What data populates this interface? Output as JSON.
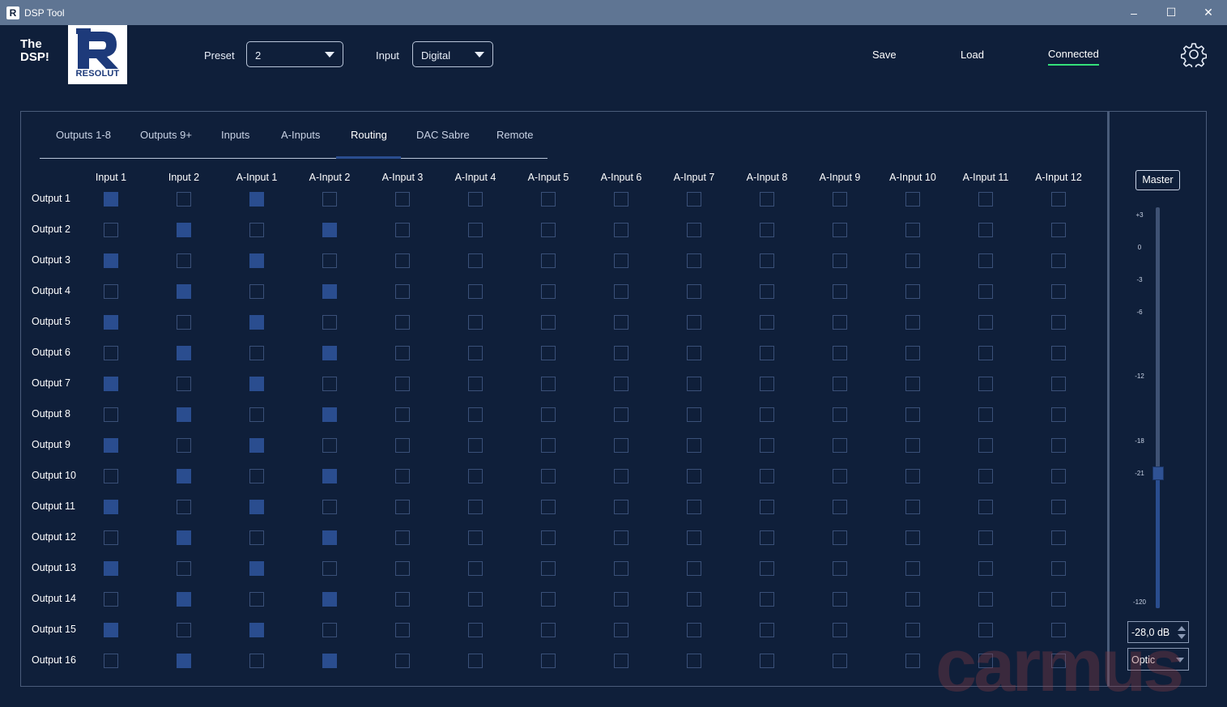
{
  "window": {
    "title": "DSP Tool",
    "app_icon_letter": "R",
    "minimize": "–",
    "maximize": "☐",
    "close": "✕"
  },
  "brand": {
    "line1": "The",
    "line2": "DSP!",
    "logo_text": "RESOLUT"
  },
  "header": {
    "preset_label": "Preset",
    "preset_value": "2",
    "input_label": "Input",
    "input_value": "Digital",
    "save": "Save",
    "load": "Load",
    "connection_status": "Connected",
    "settings_icon": "gear-icon"
  },
  "tabs": [
    {
      "label": "Outputs 1-8",
      "active": false
    },
    {
      "label": "Outputs 9+",
      "active": false
    },
    {
      "label": "Inputs",
      "active": false
    },
    {
      "label": "A-Inputs",
      "active": false
    },
    {
      "label": "Routing",
      "active": true
    },
    {
      "label": "DAC Sabre",
      "active": false
    },
    {
      "label": "Remote",
      "active": false
    }
  ],
  "routing": {
    "columns": [
      "Input 1",
      "Input 2",
      "A-Input 1",
      "A-Input 2",
      "A-Input 3",
      "A-Input 4",
      "A-Input 5",
      "A-Input 6",
      "A-Input 7",
      "A-Input 8",
      "A-Input 9",
      "A-Input 10",
      "A-Input 11",
      "A-Input 12"
    ],
    "rows": [
      {
        "label": "Output 1",
        "on": [
          1,
          0,
          1,
          0,
          0,
          0,
          0,
          0,
          0,
          0,
          0,
          0,
          0,
          0
        ]
      },
      {
        "label": "Output 2",
        "on": [
          0,
          1,
          0,
          1,
          0,
          0,
          0,
          0,
          0,
          0,
          0,
          0,
          0,
          0
        ]
      },
      {
        "label": "Output 3",
        "on": [
          1,
          0,
          1,
          0,
          0,
          0,
          0,
          0,
          0,
          0,
          0,
          0,
          0,
          0
        ]
      },
      {
        "label": "Output 4",
        "on": [
          0,
          1,
          0,
          1,
          0,
          0,
          0,
          0,
          0,
          0,
          0,
          0,
          0,
          0
        ]
      },
      {
        "label": "Output 5",
        "on": [
          1,
          0,
          1,
          0,
          0,
          0,
          0,
          0,
          0,
          0,
          0,
          0,
          0,
          0
        ]
      },
      {
        "label": "Output 6",
        "on": [
          0,
          1,
          0,
          1,
          0,
          0,
          0,
          0,
          0,
          0,
          0,
          0,
          0,
          0
        ]
      },
      {
        "label": "Output 7",
        "on": [
          1,
          0,
          1,
          0,
          0,
          0,
          0,
          0,
          0,
          0,
          0,
          0,
          0,
          0
        ]
      },
      {
        "label": "Output 8",
        "on": [
          0,
          1,
          0,
          1,
          0,
          0,
          0,
          0,
          0,
          0,
          0,
          0,
          0,
          0
        ]
      },
      {
        "label": "Output 9",
        "on": [
          1,
          0,
          1,
          0,
          0,
          0,
          0,
          0,
          0,
          0,
          0,
          0,
          0,
          0
        ]
      },
      {
        "label": "Output 10",
        "on": [
          0,
          1,
          0,
          1,
          0,
          0,
          0,
          0,
          0,
          0,
          0,
          0,
          0,
          0
        ]
      },
      {
        "label": "Output 11",
        "on": [
          1,
          0,
          1,
          0,
          0,
          0,
          0,
          0,
          0,
          0,
          0,
          0,
          0,
          0
        ]
      },
      {
        "label": "Output 12",
        "on": [
          0,
          1,
          0,
          1,
          0,
          0,
          0,
          0,
          0,
          0,
          0,
          0,
          0,
          0
        ]
      },
      {
        "label": "Output 13",
        "on": [
          1,
          0,
          1,
          0,
          0,
          0,
          0,
          0,
          0,
          0,
          0,
          0,
          0,
          0
        ]
      },
      {
        "label": "Output 14",
        "on": [
          0,
          1,
          0,
          1,
          0,
          0,
          0,
          0,
          0,
          0,
          0,
          0,
          0,
          0
        ]
      },
      {
        "label": "Output 15",
        "on": [
          1,
          0,
          1,
          0,
          0,
          0,
          0,
          0,
          0,
          0,
          0,
          0,
          0,
          0
        ]
      },
      {
        "label": "Output 16",
        "on": [
          0,
          1,
          0,
          1,
          0,
          0,
          0,
          0,
          0,
          0,
          0,
          0,
          0,
          0
        ]
      }
    ]
  },
  "master": {
    "label": "Master",
    "scale": [
      "+3",
      "0",
      "-3",
      "-6",
      "-12",
      "-18",
      "-21",
      "-120"
    ],
    "slider_level_db": -21,
    "value_text": "-28,0 dB",
    "source_value": "Optic"
  },
  "watermark": "carmus",
  "colors": {
    "background": "#0f1f3a",
    "accent": "#2a4d8f",
    "connected": "#34e07a",
    "titlebar": "#5f7593"
  }
}
